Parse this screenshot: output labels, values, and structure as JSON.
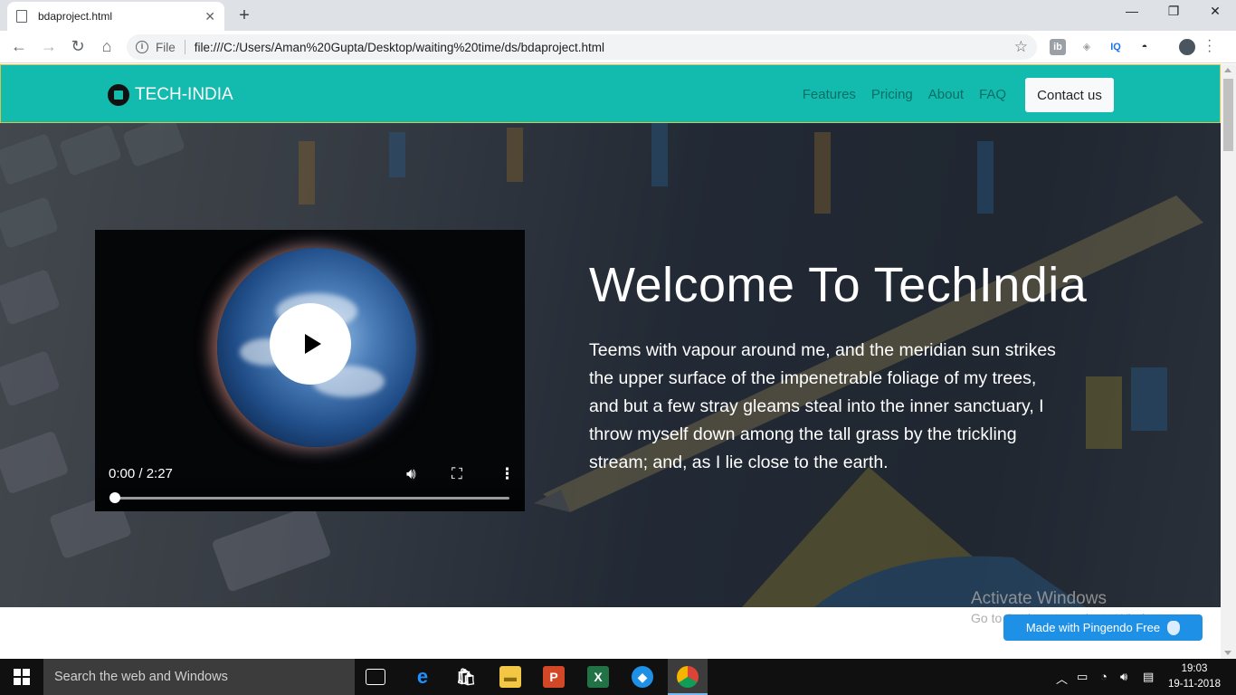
{
  "browser": {
    "tab_title": "bdaproject.html",
    "tab_close": "✕",
    "new_tab": "+",
    "window_controls": [
      "—",
      "❐",
      "✕"
    ],
    "scheme_label": "File",
    "url": "file:///C:/Users/Aman%20Gupta/Desktop/waiting%20time/ds/bdaproject.html",
    "extensions": [
      "ib",
      "tag",
      "IQ",
      "ghost",
      "avatar"
    ]
  },
  "site": {
    "brand": "TECH-INDIA",
    "nav_links": [
      "Features",
      "Pricing",
      "About",
      "FAQ"
    ],
    "contact_button": "Contact us",
    "hero_title": "Welcome To TechIndia",
    "hero_text": "Teems with vapour around me, and the meridian sun strikes the upper surface of the impenetrable foliage of my trees, and but a few stray gleams steal into the inner sanctuary, I throw myself down among the tall grass by the trickling stream; and, as I lie close to the earth.",
    "video": {
      "time": "0:00 / 2:27",
      "progress": 0
    },
    "pingendo_badge": "Made with Pingendo Free"
  },
  "watermark": {
    "line1": "Activate Windows",
    "line2": "Go to Settings to activate Windows."
  },
  "taskbar": {
    "search_placeholder": "Search the web and Windows",
    "time": "19:03",
    "date": "19-11-2018"
  },
  "colors": {
    "navbar": "#12bbad",
    "nav_link": "#0c6e66",
    "pingendo": "#1e90e6"
  }
}
